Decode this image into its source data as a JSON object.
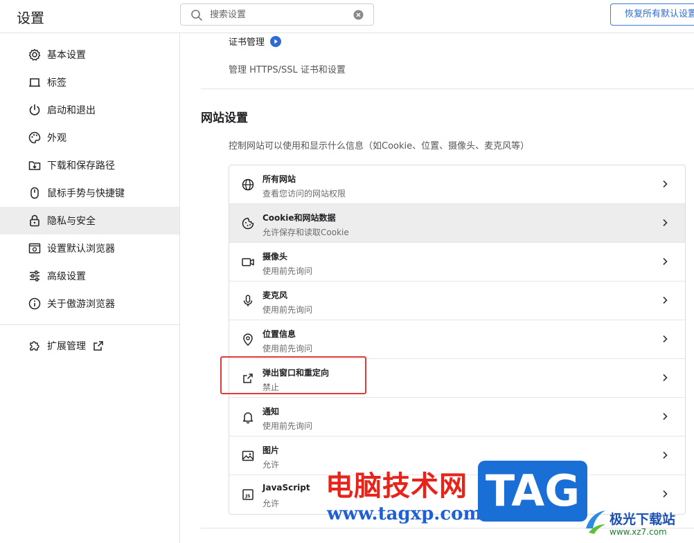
{
  "header": {
    "title": "设置",
    "search_placeholder": "搜索设置",
    "restore_label": "恢复所有默认设置"
  },
  "sidebar": {
    "items": [
      {
        "label": "基本设置",
        "icon": "gear-icon"
      },
      {
        "label": "标签",
        "icon": "tab-icon"
      },
      {
        "label": "启动和退出",
        "icon": "power-icon"
      },
      {
        "label": "外观",
        "icon": "palette-icon"
      },
      {
        "label": "下载和保存路径",
        "icon": "download-folder-icon"
      },
      {
        "label": "鼠标手势与快捷键",
        "icon": "mouse-icon"
      },
      {
        "label": "隐私与安全",
        "icon": "lock-icon",
        "active": true
      },
      {
        "label": "设置默认浏览器",
        "icon": "browser-icon"
      },
      {
        "label": "高级设置",
        "icon": "sliders-icon"
      },
      {
        "label": "关于傲游浏览器",
        "icon": "info-icon"
      }
    ],
    "extensions_label": "扩展管理"
  },
  "main": {
    "cert_title": "证书管理",
    "cert_desc": "管理 HTTPS/SSL 证书和设置",
    "section_title": "网站设置",
    "section_desc": "控制网站可以使用和显示什么信息（如Cookie、位置、摄像头、麦克风等）",
    "rows": [
      {
        "title": "所有网站",
        "subtitle": "查看您访问的网站权限",
        "icon": "globe-icon"
      },
      {
        "title": "Cookie和网站数据",
        "subtitle": "允许保存和读取Cookie",
        "icon": "cookie-icon",
        "hover": true
      },
      {
        "title": "摄像头",
        "subtitle": "使用前先询问",
        "icon": "camera-icon"
      },
      {
        "title": "麦克风",
        "subtitle": "使用前先询问",
        "icon": "microphone-icon"
      },
      {
        "title": "位置信息",
        "subtitle": "使用前先询问",
        "icon": "location-pin-icon"
      },
      {
        "title": "弹出窗口和重定向",
        "subtitle": "禁止",
        "icon": "popup-external-icon"
      },
      {
        "title": "通知",
        "subtitle": "使用前先询问",
        "icon": "bell-icon"
      },
      {
        "title": "图片",
        "subtitle": "允许",
        "icon": "image-icon"
      },
      {
        "title": "JavaScript",
        "subtitle": "允许",
        "icon": "js-icon"
      }
    ]
  },
  "watermark": {
    "cn_text": "电脑技术网",
    "url_text": "www.tagxp.com",
    "tag_text": "TAG",
    "site_cn": "极光下载站",
    "site_url": "www.xz7.com"
  },
  "colors": {
    "accent": "#2e6cd1",
    "highlight": "#e03a3a",
    "active_bg": "#ededed"
  }
}
